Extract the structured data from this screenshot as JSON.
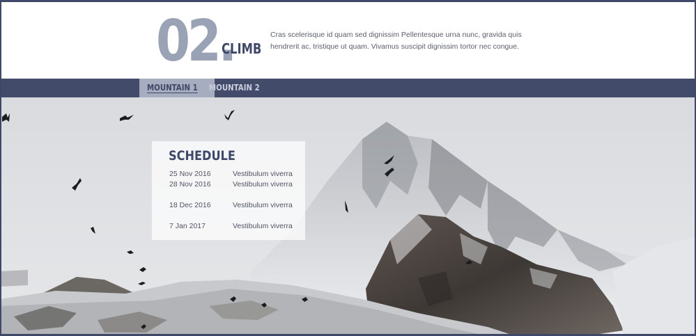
{
  "header": {
    "number": "02.",
    "title": "CLIMB",
    "intro": "Cras scelerisque id quam sed dignissim Pellentesque urna nunc, gravida quis hendrerit ac, tristique ut quam. Vivamus suscipit dignissim tortor nec congue."
  },
  "tabs": [
    {
      "label": "MOUNTAIN 1",
      "active": true
    },
    {
      "label": "MOUNTAIN 2",
      "active": false
    }
  ],
  "schedule": {
    "title": "SCHEDULE",
    "rows": [
      {
        "date": "25 Nov 2016",
        "event": "Vestibulum viverra"
      },
      {
        "date": "28 Nov 2016",
        "event": "Vestibulum viverra"
      },
      {
        "date": "18 Dec 2016",
        "event": "Vestibulum viverra"
      },
      {
        "date": "7 Jan 2017",
        "event": "Vestibulum viverra"
      }
    ]
  },
  "colors": {
    "accent": "#434b6b",
    "number": "#9aa3b6",
    "tab_active_bg": "#a6adbf"
  }
}
